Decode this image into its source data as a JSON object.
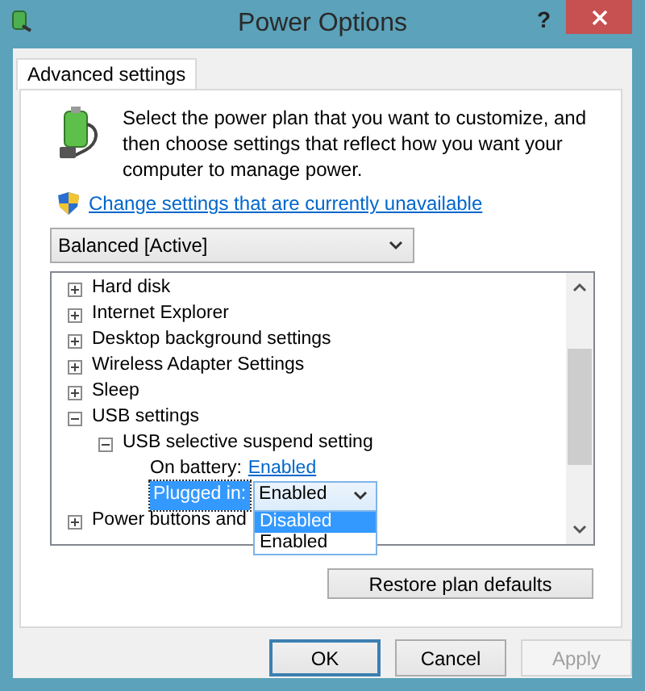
{
  "window": {
    "title": "Power Options",
    "help": "?"
  },
  "tabs": [
    {
      "label": "Advanced settings",
      "selected": true
    }
  ],
  "description": "Select the power plan that you want to customize, and then choose settings that reflect how you want your computer to manage power.",
  "change_link": "Change settings that are currently unavailable",
  "plan_select": {
    "value": "Balanced [Active]"
  },
  "tree": [
    {
      "label": "Hard disk",
      "expanded": false
    },
    {
      "label": "Internet Explorer",
      "expanded": false
    },
    {
      "label": "Desktop background settings",
      "expanded": false
    },
    {
      "label": "Wireless Adapter Settings",
      "expanded": false
    },
    {
      "label": "Sleep",
      "expanded": false
    },
    {
      "label": "USB settings",
      "expanded": true,
      "children": [
        {
          "label": "USB selective suspend setting",
          "expanded": true,
          "children": [
            {
              "kind": "link",
              "label": "On battery:",
              "value": "Enabled"
            },
            {
              "kind": "dropdown",
              "label": "Plugged in:",
              "value": "Enabled",
              "selected": true,
              "open": true,
              "options": [
                {
                  "label": "Disabled",
                  "highlighted": true
                },
                {
                  "label": "Enabled",
                  "highlighted": false
                }
              ]
            }
          ]
        }
      ]
    },
    {
      "label": "Power buttons and",
      "expanded": false
    }
  ],
  "restore_button": "Restore plan defaults",
  "buttons": [
    {
      "label": "OK",
      "default": true,
      "disabled": false
    },
    {
      "label": "Cancel",
      "default": false,
      "disabled": false
    },
    {
      "label": "Apply",
      "default": false,
      "disabled": true
    }
  ]
}
